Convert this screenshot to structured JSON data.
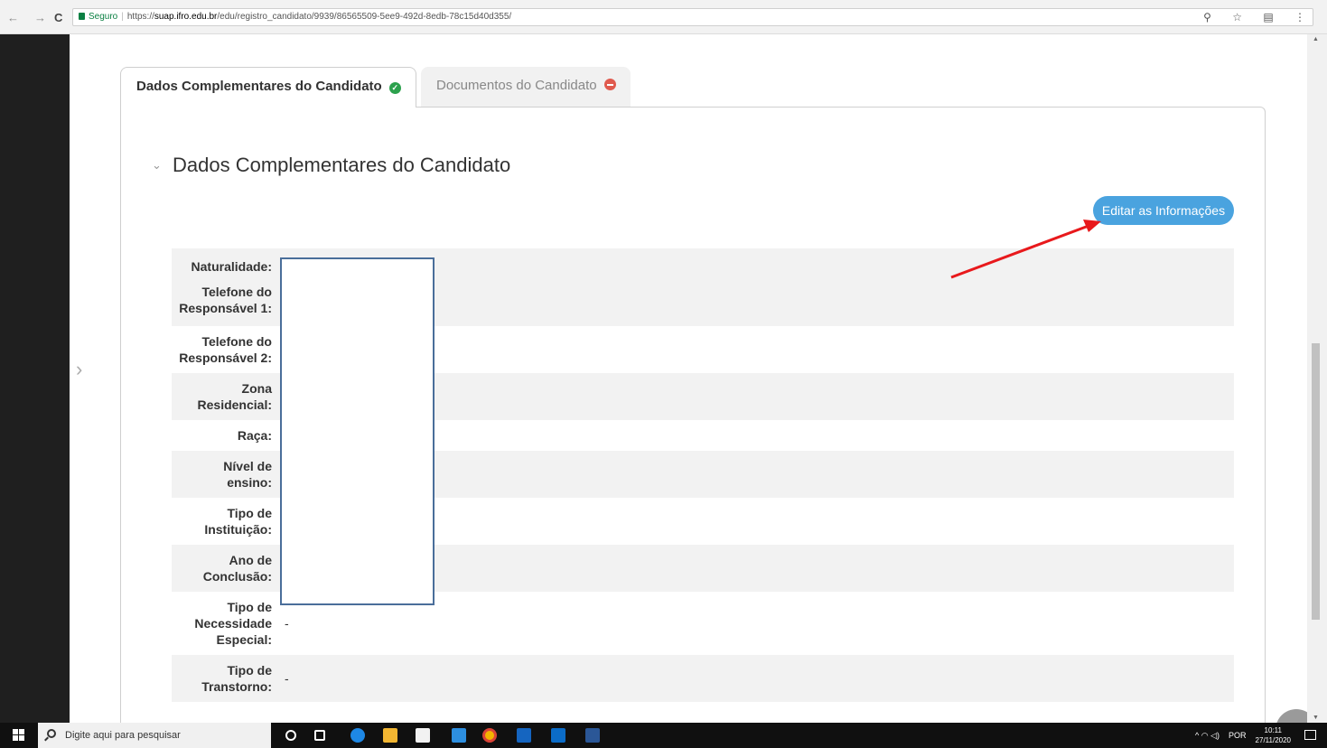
{
  "browser": {
    "secure_label": "Seguro",
    "url_prefix": "https://",
    "url_domain": "suap.ifro.edu.br",
    "url_path": "/edu/registro_candidato/9939/86565509-5ee9-492d-8edb-78c15d40d355/",
    "back_icon": "←",
    "forward_icon": "→",
    "reload_icon": "C",
    "right_icons": "⚲ ☆ ▤ ⋮"
  },
  "tabs": [
    {
      "label": "Dados Complementares do Candidato",
      "status": "ok"
    },
    {
      "label": "Documentos do Candidato",
      "status": "error"
    }
  ],
  "section": {
    "toggle_icon": "⌄",
    "title": "Dados Complementares do Candidato"
  },
  "edit_button": "Editar as Informações",
  "fields": [
    {
      "label_lines": [
        "Naturalidade:"
      ],
      "value": ""
    },
    {
      "label_lines": [
        "Telefone do",
        "Responsável 1:"
      ],
      "value": ""
    },
    {
      "label_lines": [
        "Telefone do",
        "Responsável 2:"
      ],
      "value": ""
    },
    {
      "label_lines": [
        "Zona",
        "Residencial:"
      ],
      "value": ""
    },
    {
      "label_lines": [
        "Raça:"
      ],
      "value": ""
    },
    {
      "label_lines": [
        "Nível de",
        "ensino:"
      ],
      "value": ""
    },
    {
      "label_lines": [
        "Tipo de",
        "Instituição:"
      ],
      "value": ""
    },
    {
      "label_lines": [
        "Ano de",
        "Conclusão:"
      ],
      "value": ""
    },
    {
      "label_lines": [
        "Tipo de",
        "Necessidade",
        "Especial:"
      ],
      "value": "-"
    },
    {
      "label_lines": [
        "Tipo de",
        "Transtorno:"
      ],
      "value": "-"
    }
  ],
  "taskbar": {
    "search_placeholder": "Digite aqui para pesquisar",
    "lang": "POR",
    "time": "10:11",
    "date": "27/11/2020",
    "tray_icons": "^ ◠ ◁)"
  },
  "colors": {
    "accent": "#4aa3df",
    "ok": "#2ca14d",
    "error": "#e05a4e",
    "annotation_arrow": "#e8191c"
  }
}
